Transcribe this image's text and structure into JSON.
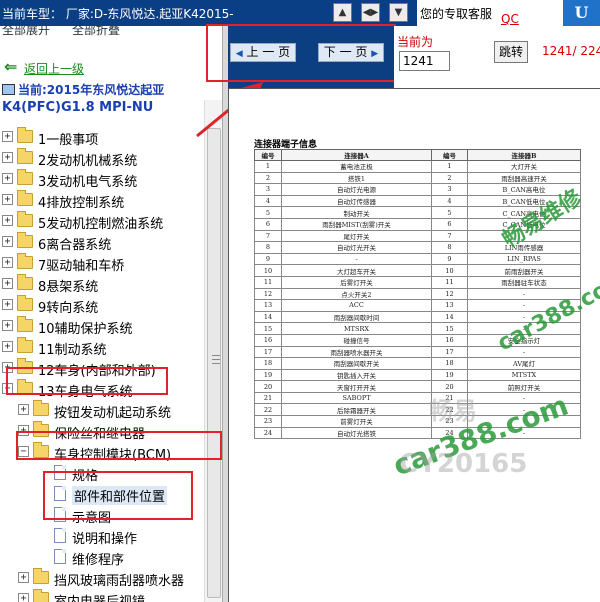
{
  "titlebar": {
    "title": "当前车型：  厂家:D-东风悦达.起亚K42015-",
    "buttons": [
      "▲",
      "◀▶",
      "▼"
    ],
    "brand_text": "您的专取客服",
    "brand_link": "QC",
    "logo_text": "U"
  },
  "left_panel": {
    "menu_items": [
      "全部展开",
      "全部折叠"
    ],
    "back_label": "返回上一级",
    "back_arrow": "⇐",
    "current_label": "当前:2015年东风悦达起亚",
    "model_label": "K4(PFC)G1.8 MPI-NU",
    "tree": [
      {
        "label": "1一般事项",
        "toggle": "+"
      },
      {
        "label": "2发动机机械系统",
        "toggle": "+"
      },
      {
        "label": "3发动机电气系统",
        "toggle": "+"
      },
      {
        "label": "4排放控制系统",
        "toggle": "+"
      },
      {
        "label": "5发动机控制燃油系统",
        "toggle": "+"
      },
      {
        "label": "6离合器系统",
        "toggle": "+"
      },
      {
        "label": "7驱动轴和车桥",
        "toggle": "+"
      },
      {
        "label": "8悬架系统",
        "toggle": "+"
      },
      {
        "label": "9转向系统",
        "toggle": "+"
      },
      {
        "label": "10辅助保护系统",
        "toggle": "+"
      },
      {
        "label": "11制动系统",
        "toggle": "+"
      },
      {
        "label": "12车身(内部和外部)",
        "toggle": "+"
      },
      {
        "label": "13车身电气系统",
        "toggle": "−"
      },
      {
        "label": "按钮发动机起动系统",
        "toggle": "+"
      },
      {
        "label": "保险丝和继电器",
        "toggle": "+"
      },
      {
        "label": "车身控制模块(BCM)",
        "toggle": "−"
      },
      {
        "label": "规格",
        "toggle": ""
      },
      {
        "label": "部件和部件位置",
        "toggle": ""
      },
      {
        "label": "示意图",
        "toggle": ""
      },
      {
        "label": "说明和操作",
        "toggle": ""
      },
      {
        "label": "维修程序",
        "toggle": ""
      },
      {
        "label": "挡风玻璃雨刮器喷水器",
        "toggle": "+"
      },
      {
        "label": "室内电器后视镜",
        "toggle": "+"
      }
    ]
  },
  "navigation": {
    "prev_label": "上 一 页",
    "next_label": "下 一 页",
    "current_page_label": "当前为",
    "page_input_value": "1241",
    "jump_label": "跳转",
    "total_pages": "1241/ 2245"
  },
  "document": {
    "title": "连接器端子信息",
    "headers": [
      "编号",
      "连接器A",
      "编号",
      "连接器B"
    ],
    "rows": [
      [
        "1",
        "蓄电池正极",
        "1",
        "大灯开关"
      ],
      [
        "2",
        "搭铁1",
        "2",
        "雨刮器高速开关"
      ],
      [
        "3",
        "自动灯光电源",
        "3",
        "B_CAN高电位"
      ],
      [
        "4",
        "自动灯传感器",
        "4",
        "B_CAN低电位"
      ],
      [
        "5",
        "制动开关",
        "5",
        "C_CAN高电位"
      ],
      [
        "6",
        "雨刮器MIST(刮雾)开关",
        "6",
        "C_CAN低电位"
      ],
      [
        "7",
        "尾灯开关",
        "7",
        "-"
      ],
      [
        "8",
        "自动灯光开关",
        "8",
        "LIN雨传感器"
      ],
      [
        "9",
        "-",
        "9",
        "LIN_RPAS"
      ],
      [
        "10",
        "大灯超车开关",
        "10",
        "前雨刮器开关"
      ],
      [
        "11",
        "后雾灯开关",
        "11",
        "雨刮器驻车状态"
      ],
      [
        "12",
        "点火开关2",
        "12",
        "-"
      ],
      [
        "13",
        "ACC",
        "13",
        "-"
      ],
      [
        "14",
        "雨刮器间歇时间",
        "14",
        "-"
      ],
      [
        "15",
        "MTSRX",
        "15",
        "-"
      ],
      [
        "16",
        "碰撞信号",
        "16",
        "安全指示灯"
      ],
      [
        "17",
        "雨刮器喷水器开关",
        "17",
        "-"
      ],
      [
        "18",
        "雨刮器间歇开关",
        "18",
        "AV尾灯"
      ],
      [
        "19",
        "钥匙插入开关",
        "19",
        "MTSTX"
      ],
      [
        "20",
        "天窗打开开关",
        "20",
        "前照灯开关"
      ],
      [
        "21",
        "SABOPT",
        "21",
        "-"
      ],
      [
        "22",
        "后除霜器开关",
        "22",
        "-"
      ],
      [
        "23",
        "前雾灯开关",
        "23",
        "-"
      ],
      [
        "24",
        "自动灯光搭铁",
        "24",
        "-"
      ]
    ],
    "watermarks": [
      "畅易维修",
      "car388.com",
      "畅易",
      "car388.com",
      "CY20165"
    ]
  },
  "colors": {
    "titlebar_bg": "#0a3f86",
    "nav_bg": "#0b3f82",
    "highlight": "#e0222a",
    "link_green": "#1a8a1a",
    "current_blue": "#1a3fb0",
    "watermark_green": "#2a9a3a"
  }
}
